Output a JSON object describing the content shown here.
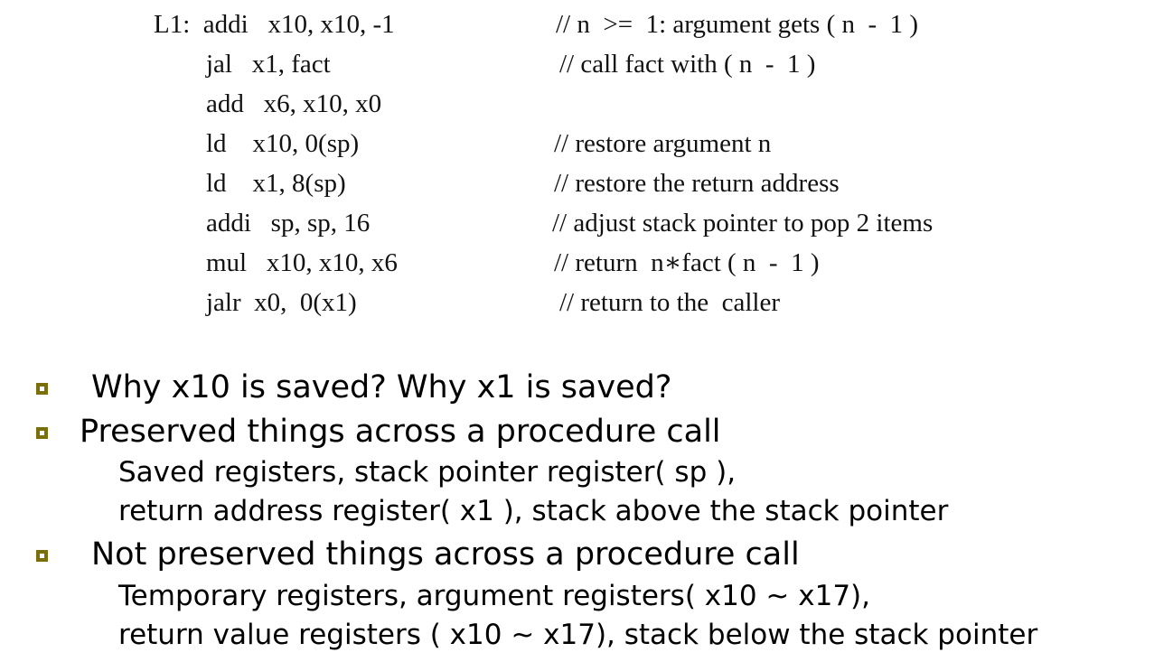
{
  "code_lines": [
    {
      "code": "L1:  addi   x10, x10, -1",
      "comment": "// n  >=  1: argument gets ( n  -  1 )"
    },
    {
      "code": "jal   x1, fact",
      "comment": "// call fact with ( n  -  1 )"
    },
    {
      "code": "add   x6, x10, x0",
      "comment": ""
    },
    {
      "code": "ld    x10, 0(sp)",
      "comment": "// restore argument n"
    },
    {
      "code": "ld    x1, 8(sp)",
      "comment": "// restore the return address"
    },
    {
      "code": "addi   sp, sp, 16",
      "comment": "// adjust stack pointer to pop 2 items"
    },
    {
      "code": "mul   x10, x10, x6",
      "comment": "// return  n∗fact ( n  -  1 )"
    },
    {
      "code": "jalr  x0,  0(x1)",
      "comment": "// return to the  caller"
    }
  ],
  "bullets": [
    {
      "text": "Why x10 is saved? Why x1 is saved?",
      "sub": []
    },
    {
      "text": "Preserved things across a procedure call",
      "sub": [
        "Saved registers, stack pointer register( sp ),",
        "return address register( x1 ), stack above the stack pointer"
      ]
    },
    {
      "text": "Not preserved things across a procedure call",
      "sub": [
        "Temporary registers, argument registers( x10 ~ x17),",
        "return value registers ( x10 ~ x17), stack below the stack pointer"
      ]
    }
  ],
  "colors": {
    "bullet_border": "#7a6f0a",
    "text": "#000000"
  }
}
